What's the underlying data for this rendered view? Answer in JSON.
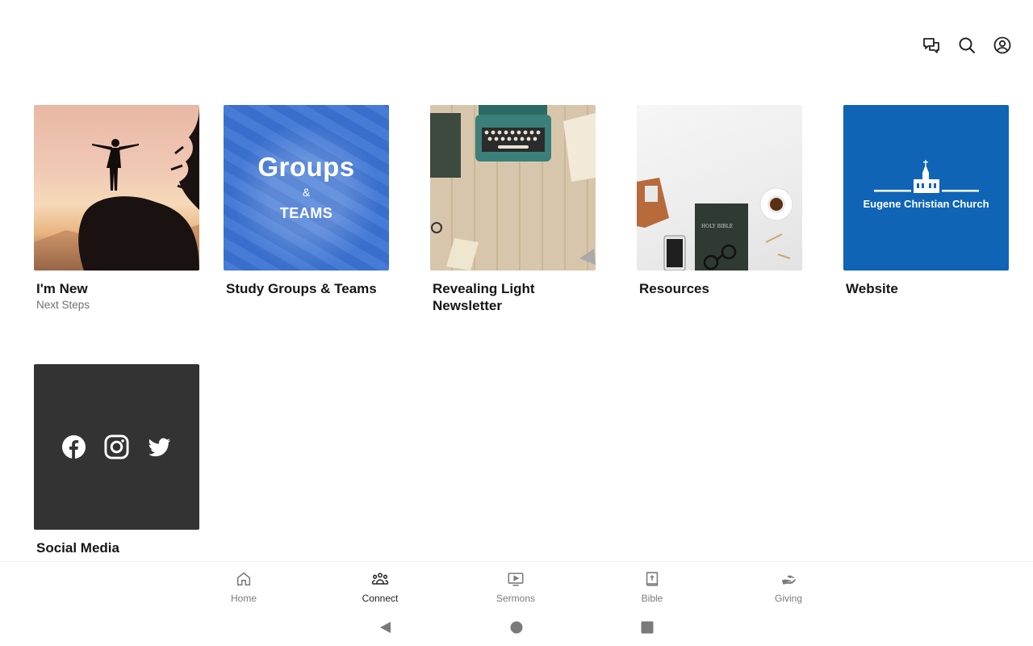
{
  "topbar": {
    "icons": [
      "chat-icon",
      "search-icon",
      "account-icon"
    ]
  },
  "cards": [
    {
      "title": "I'm New",
      "subtitle": "Next Steps",
      "image": "person-on-rock-sunset"
    },
    {
      "title": "Study Groups & Teams",
      "image": "groups-teams-graphic",
      "graphic_text": {
        "word1": "Groups",
        "amp": "&",
        "word2": "TEAMS"
      }
    },
    {
      "title": "Revealing Light Newsletter",
      "image": "typewriter-desk"
    },
    {
      "title": "Resources",
      "image": "bible-desk"
    },
    {
      "title": "Website",
      "image": "church-logo",
      "graphic_text": {
        "church": "Eugene Christian Church"
      }
    },
    {
      "title": "Social Media",
      "image": "social-icons"
    }
  ],
  "bottom_nav": {
    "active": "Connect",
    "items": [
      {
        "label": "Home",
        "icon": "home-icon"
      },
      {
        "label": "Connect",
        "icon": "people-icon"
      },
      {
        "label": "Sermons",
        "icon": "video-icon"
      },
      {
        "label": "Bible",
        "icon": "bible-icon"
      },
      {
        "label": "Giving",
        "icon": "giving-icon"
      }
    ]
  },
  "system_nav": [
    "back-icon",
    "home-circle-icon",
    "recents-icon"
  ],
  "colors": {
    "groups_blue": "#3b73d4",
    "website_blue": "#0f64b6",
    "social_dark": "#333333",
    "nav_inactive": "#7a7a7a"
  }
}
